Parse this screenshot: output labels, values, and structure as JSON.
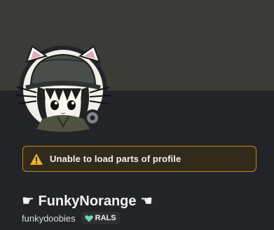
{
  "profile": {
    "display_name": "☛ FunkyNorange ☚",
    "username": "funkydoobies",
    "guild_tag": "RALS",
    "status": "offline"
  },
  "warning": {
    "message": "Unable to load parts of profile"
  },
  "colors": {
    "banner": "#3b3c38",
    "card_background": "#232428",
    "warning_border": "#c28a15",
    "warning_icon": "#f0b232",
    "tag_heart": "#6fd6b6"
  },
  "icons": {
    "warning": "warning-triangle-icon",
    "tag": "heart-icon",
    "status": "offline-status-icon"
  }
}
